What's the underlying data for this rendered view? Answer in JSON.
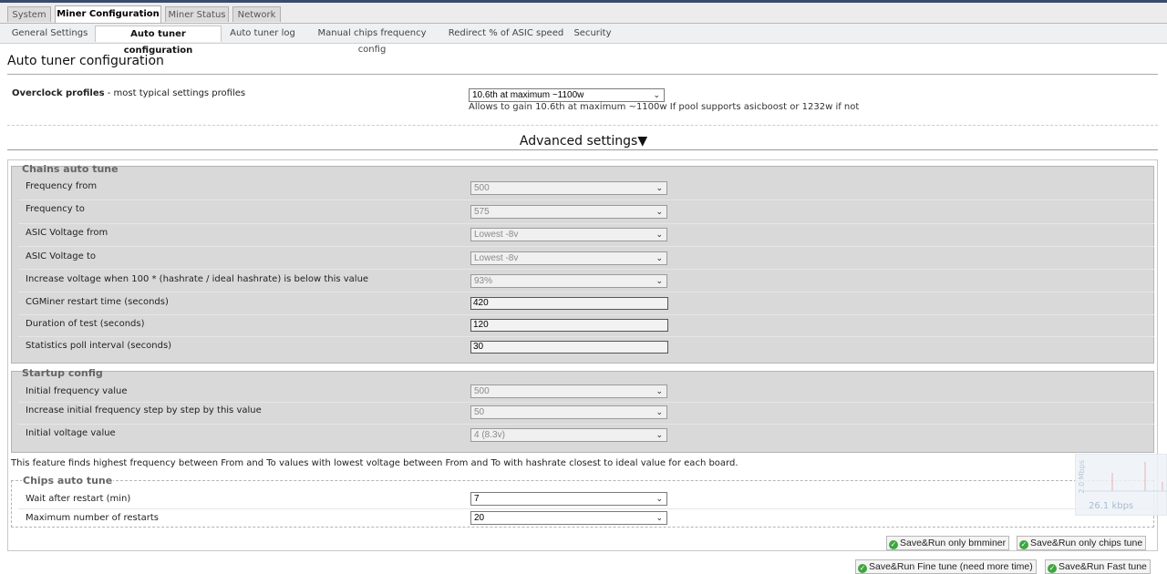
{
  "main_tabs": [
    "System",
    "Miner Configuration",
    "Miner Status",
    "Network"
  ],
  "sub_tabs": [
    "General Settings",
    "Auto tuner configuration",
    "Auto tuner log",
    "Manual chips frequency config",
    "Redirect % of ASIC speed",
    "Security"
  ],
  "page_title": "Auto tuner configuration",
  "overclock": {
    "label": "Overclock profiles",
    "label_suffix": " - most typical settings profiles",
    "value": "10.6th at maximum ~1100w",
    "description": "Allows to gain 10.6th at maximum ~1100w If pool supports asicboost or 1232w if not"
  },
  "advanced_title": "Advanced settings▼",
  "chains": {
    "legend": "Chains auto tune",
    "rows": [
      {
        "label": "Frequency from",
        "value": "500"
      },
      {
        "label": "Frequency to",
        "value": "575"
      },
      {
        "label": "ASIC Voltage from",
        "value": "Lowest -8v"
      },
      {
        "label": "ASIC Voltage to",
        "value": "Lowest -8v"
      },
      {
        "label": "Increase voltage when 100 * (hashrate / ideal hashrate) is below this value",
        "value": "93%"
      },
      {
        "label": "CGMiner restart time (seconds)",
        "value": "420"
      },
      {
        "label": "Duration of test (seconds)",
        "value": "120"
      },
      {
        "label": "Statistics poll interval (seconds)",
        "value": "30"
      }
    ]
  },
  "startup": {
    "legend": "Startup config",
    "rows": [
      {
        "label": "Initial frequency value",
        "value": "500"
      },
      {
        "label": "Increase initial frequency step by step by this value",
        "value": "50"
      },
      {
        "label": "Initial voltage value",
        "value": "4 (8.3v)"
      }
    ]
  },
  "feature_note": "This feature finds highest frequency between From and To values with lowest voltage between From and To with hashrate closest to ideal value for each board.",
  "chips": {
    "legend": "Chips auto tune",
    "rows": [
      {
        "label": "Wait after restart (min)",
        "value": "7"
      },
      {
        "label": "Maximum number of restarts",
        "value": "20"
      }
    ]
  },
  "buttons": {
    "save_bmminer": "Save&Run only bmminer",
    "save_chips": "Save&Run only chips tune",
    "save_fine": "Save&Run Fine tune (need more time)",
    "save_fast": "Save&Run Fast tune"
  },
  "widget": {
    "rate": "26.1 kbps",
    "vertical": "2.0 Mbps"
  }
}
